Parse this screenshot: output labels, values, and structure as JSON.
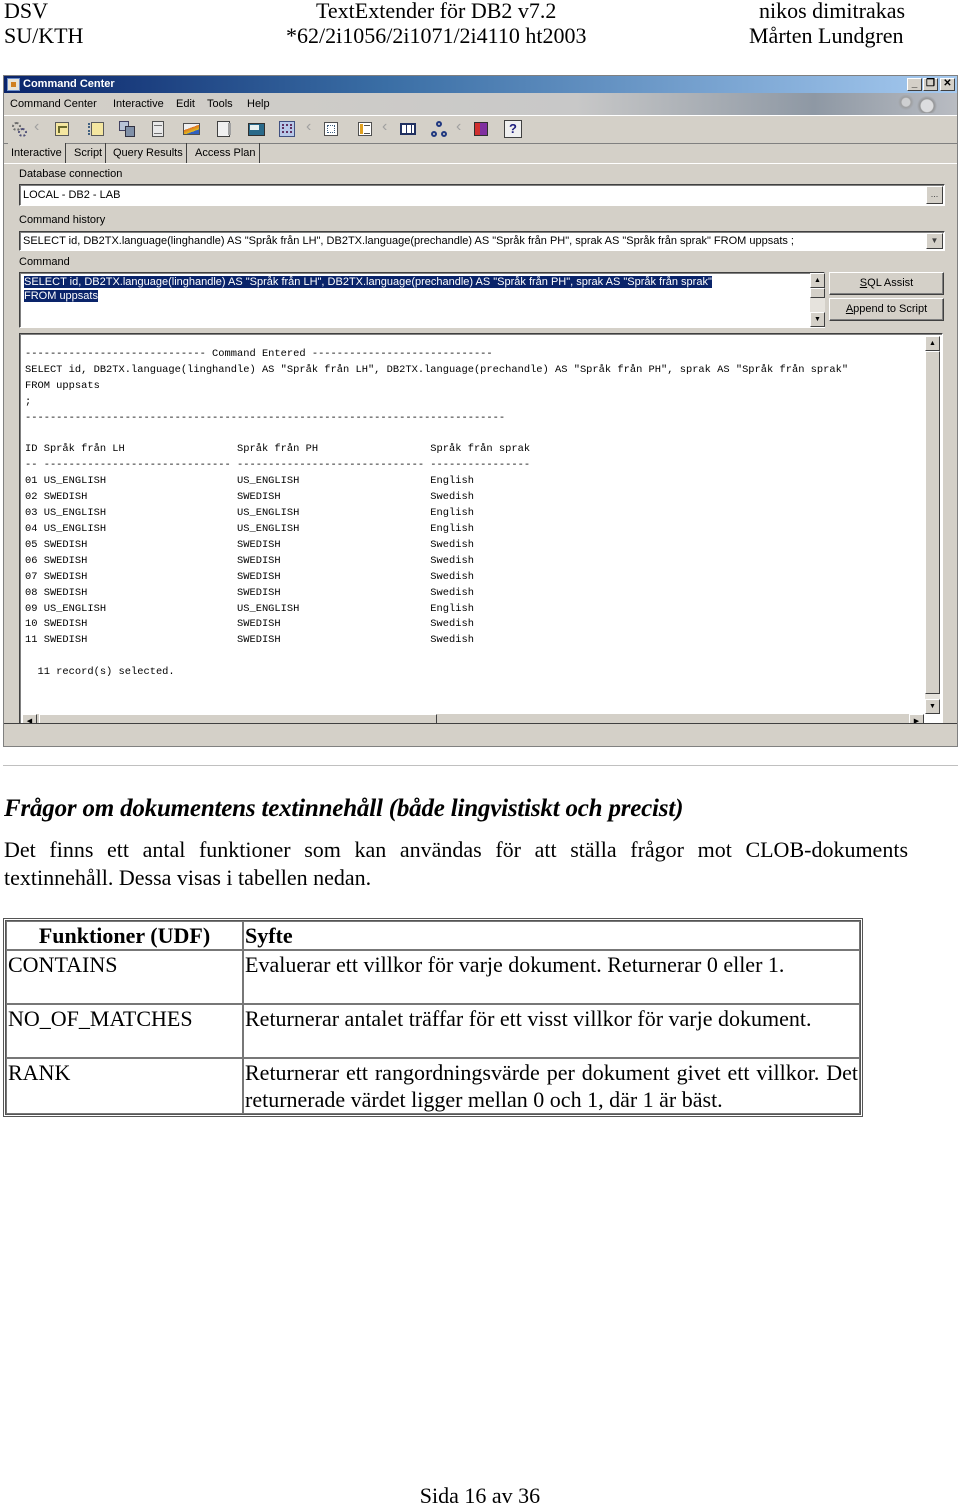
{
  "page_header": {
    "left_line1": "DSV",
    "left_line2": "SU/KTH",
    "center_line1": "TextExtender för DB2 v7.2",
    "center_line2": "*62/2i1056/2i1071/2i4110 ht2003",
    "right_line1": "nikos dimitrakas",
    "right_line2": "Mårten Lundgren"
  },
  "window": {
    "title": "Command Center",
    "controls": {
      "minimize": "_",
      "restore": "❐",
      "close": "✕"
    },
    "menu": [
      "Command Center",
      "Interactive",
      "Edit",
      "Tools",
      "Help"
    ],
    "toolbar_icons": [
      "gears-icon",
      "script-icon",
      "script-open-icon",
      "database-objects-icon",
      "document-icon",
      "graph-icon",
      "notebook-icon",
      "monitor-icon",
      "query-help-icon",
      "options-icon",
      "list-icon",
      "table-icon",
      "tree-icon",
      "book-icon",
      "help-icon"
    ],
    "help_glyph": "?",
    "tabs": [
      "Interactive",
      "Script",
      "Query Results",
      "Access Plan"
    ],
    "active_tab": "Interactive",
    "db_connection_label": "Database connection",
    "db_connection_value": "LOCAL - DB2 - LAB",
    "browse_label": "...",
    "history_label": "Command history",
    "history_value": "SELECT id, DB2TX.language(linghandle) AS \"Språk från LH\", DB2TX.language(prechandle) AS \"Språk från PH\", sprak AS \"Språk från sprak\" FROM uppsats ;",
    "command_label": "Command",
    "command_line1": "SELECT id, DB2TX.language(linghandle) AS \"Språk från LH\", DB2TX.language(prechandle) AS \"Språk från PH\", sprak AS \"Språk från sprak\"",
    "command_line2": "FROM uppsats",
    "sql_assist_button": {
      "accel": "S",
      "rest": "QL Assist"
    },
    "append_button": {
      "accel": "A",
      "rest": "ppend to Script"
    },
    "output": {
      "banner": "----------------------------- Command Entered -----------------------------",
      "sql_line1": "SELECT id, DB2TX.language(linghandle) AS \"Språk från LH\", DB2TX.language(prechandle) AS \"Språk från PH\", sprak AS \"Språk från sprak\"",
      "sql_line2": "FROM uppsats",
      "sql_line3": ";",
      "separator": "-----------------------------------------------------------------------------",
      "columns": [
        "ID",
        "Språk från LH",
        "Språk från PH",
        "Språk från sprak"
      ],
      "underline": "-- ------------------------------ ------------------------------ ----------------",
      "rows": [
        [
          "01",
          "US_ENGLISH",
          "US_ENGLISH",
          "English"
        ],
        [
          "02",
          "SWEDISH",
          "SWEDISH",
          "Swedish"
        ],
        [
          "03",
          "US_ENGLISH",
          "US_ENGLISH",
          "English"
        ],
        [
          "04",
          "US_ENGLISH",
          "US_ENGLISH",
          "English"
        ],
        [
          "05",
          "SWEDISH",
          "SWEDISH",
          "Swedish"
        ],
        [
          "06",
          "SWEDISH",
          "SWEDISH",
          "Swedish"
        ],
        [
          "07",
          "SWEDISH",
          "SWEDISH",
          "Swedish"
        ],
        [
          "08",
          "SWEDISH",
          "SWEDISH",
          "Swedish"
        ],
        [
          "09",
          "US_ENGLISH",
          "US_ENGLISH",
          "English"
        ],
        [
          "10",
          "SWEDISH",
          "SWEDISH",
          "Swedish"
        ],
        [
          "11",
          "SWEDISH",
          "SWEDISH",
          "Swedish"
        ]
      ],
      "summary": "  11 record(s) selected."
    },
    "scroll_glyphs": {
      "up": "▲",
      "down": "▼",
      "left": "◀",
      "right": "▶"
    }
  },
  "document": {
    "heading": "Frågor om dokumentens textinnehåll (både lingvistiskt och precist)",
    "paragraph": "Det finns ett antal funktioner som kan användas för att ställa frågor mot CLOB-dokuments textinnehåll. Dessa visas i tabellen nedan.",
    "table": {
      "headers": [
        "Funktioner (UDF)",
        "Syfte"
      ],
      "rows": [
        [
          "CONTAINS",
          "Evaluerar ett villkor för varje dokument. Returnerar 0 eller 1."
        ],
        [
          "NO_OF_MATCHES",
          "Returnerar antalet träffar för ett visst villkor för varje dokument."
        ],
        [
          "RANK",
          "Returnerar ett rangordningsvärde per dokument givet ett villkor. Det returnerade värdet ligger mellan 0 och 1, där 1 är bäst."
        ]
      ]
    }
  },
  "footer": {
    "page": "Sida 16 av 36"
  }
}
